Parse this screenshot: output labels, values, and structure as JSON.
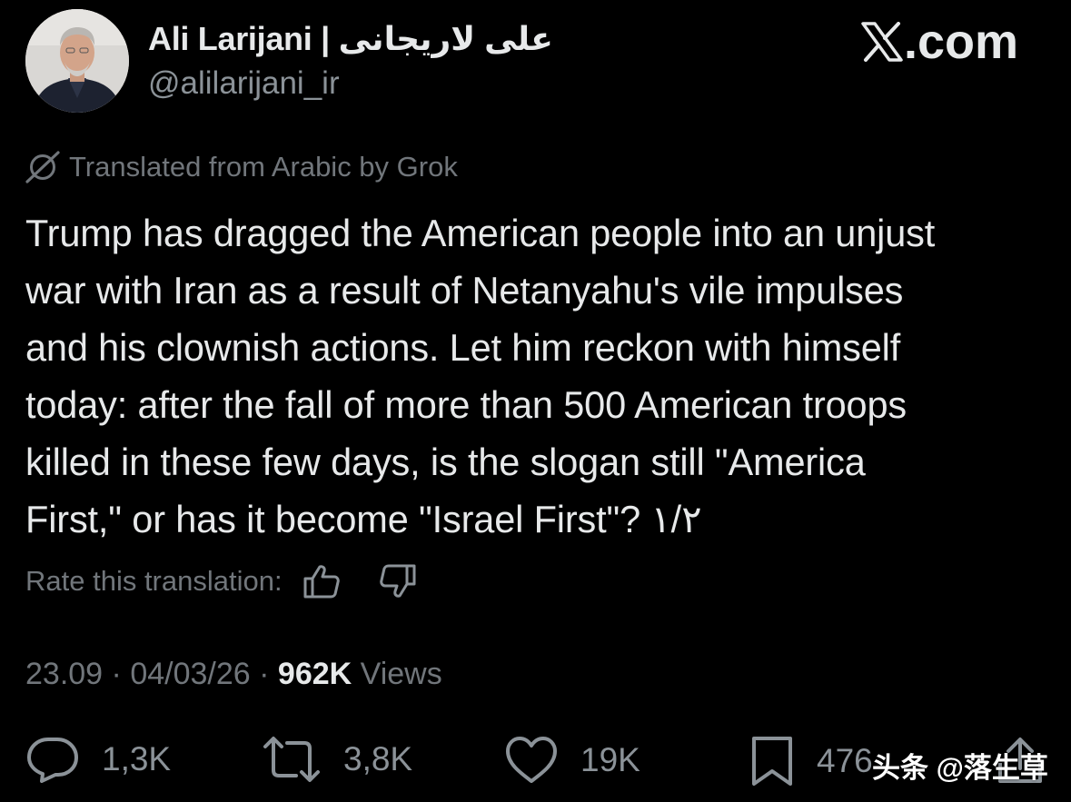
{
  "author": {
    "name": "Ali Larijani | علی لاریجانی",
    "handle": "@alilarijani_ir"
  },
  "brand": {
    "label": ".com",
    "icon": "x-logo"
  },
  "translation": {
    "notice": "Translated from Arabic by Grok",
    "rate_label": "Rate this translation:"
  },
  "tweet": {
    "text": "Trump has dragged the American people into an unjust\nwar with Iran as a result of Netanyahu's vile impulses\nand his clownish actions. Let him reckon with himself\ntoday: after the fall of more than 500 American troops\nkilled in these few days, is the slogan still \"America\nFirst,\" or has it become \"Israel First\"? ۱/۲"
  },
  "meta": {
    "time": "23.09",
    "separator": "·",
    "date": "04/03/26",
    "views_count": "962K",
    "views_label": "Views"
  },
  "actions": {
    "replies": "1,3K",
    "reposts": "3,8K",
    "likes": "19K",
    "bookmarks": "476"
  },
  "watermark": "头条 @落生草",
  "colors": {
    "background": "#000000",
    "text_primary": "#e7e9ea",
    "text_secondary": "#71767b"
  }
}
